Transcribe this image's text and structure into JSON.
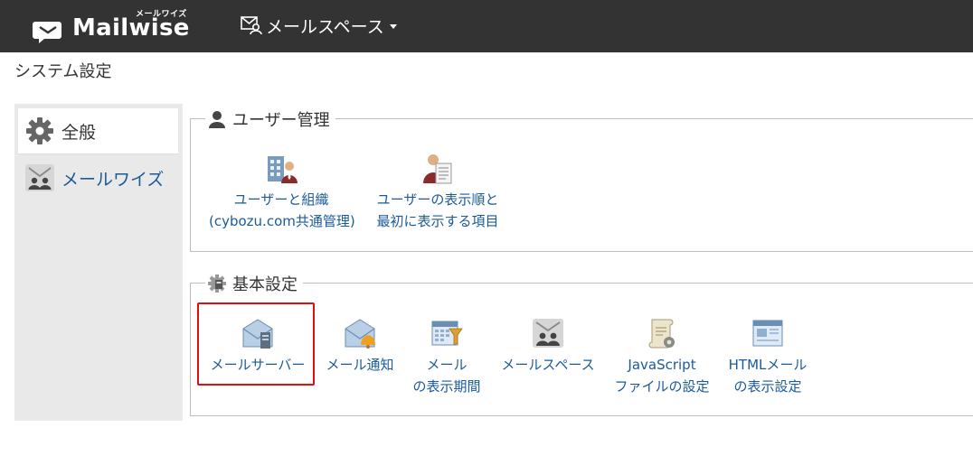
{
  "header": {
    "logo_small": "メールワイズ",
    "logo_text": "Mailwise",
    "space_menu_label": "メールスペース"
  },
  "page_title": "システム設定",
  "sidebar": {
    "items": [
      {
        "label": "全般",
        "icon": "gear-icon",
        "active": true
      },
      {
        "label": "メールワイズ",
        "icon": "mailwise-users-icon",
        "active": false
      }
    ]
  },
  "sections": [
    {
      "title": "ユーザー管理",
      "icon": "user-icon",
      "items": [
        {
          "line1": "ユーザーと組織",
          "line2": "(cybozu.com共通管理)",
          "icon": "organization-icon"
        },
        {
          "line1": "ユーザーの表示順と",
          "line2": "最初に表示する項目",
          "icon": "user-document-icon"
        }
      ]
    },
    {
      "title": "基本設定",
      "icon": "settings-gear-icon",
      "items": [
        {
          "line1": "メールサーバー",
          "line2": "",
          "icon": "mail-server-icon"
        },
        {
          "line1": "メール通知",
          "line2": "",
          "icon": "mail-notification-icon"
        },
        {
          "line1": "メール",
          "line2": "の表示期間",
          "icon": "calendar-filter-icon"
        },
        {
          "line1": "メールスペース",
          "line2": "",
          "icon": "mailspace-users-icon"
        },
        {
          "line1": "JavaScript",
          "line2": "ファイルの設定",
          "icon": "script-gear-icon"
        },
        {
          "line1": "HTMLメール",
          "line2": "の表示設定",
          "icon": "html-mail-icon"
        }
      ]
    }
  ],
  "colors": {
    "topbar": "#333333",
    "link": "#1a5a9a",
    "highlight": "#e01010",
    "sidebar_bg": "#e9e9e9"
  }
}
